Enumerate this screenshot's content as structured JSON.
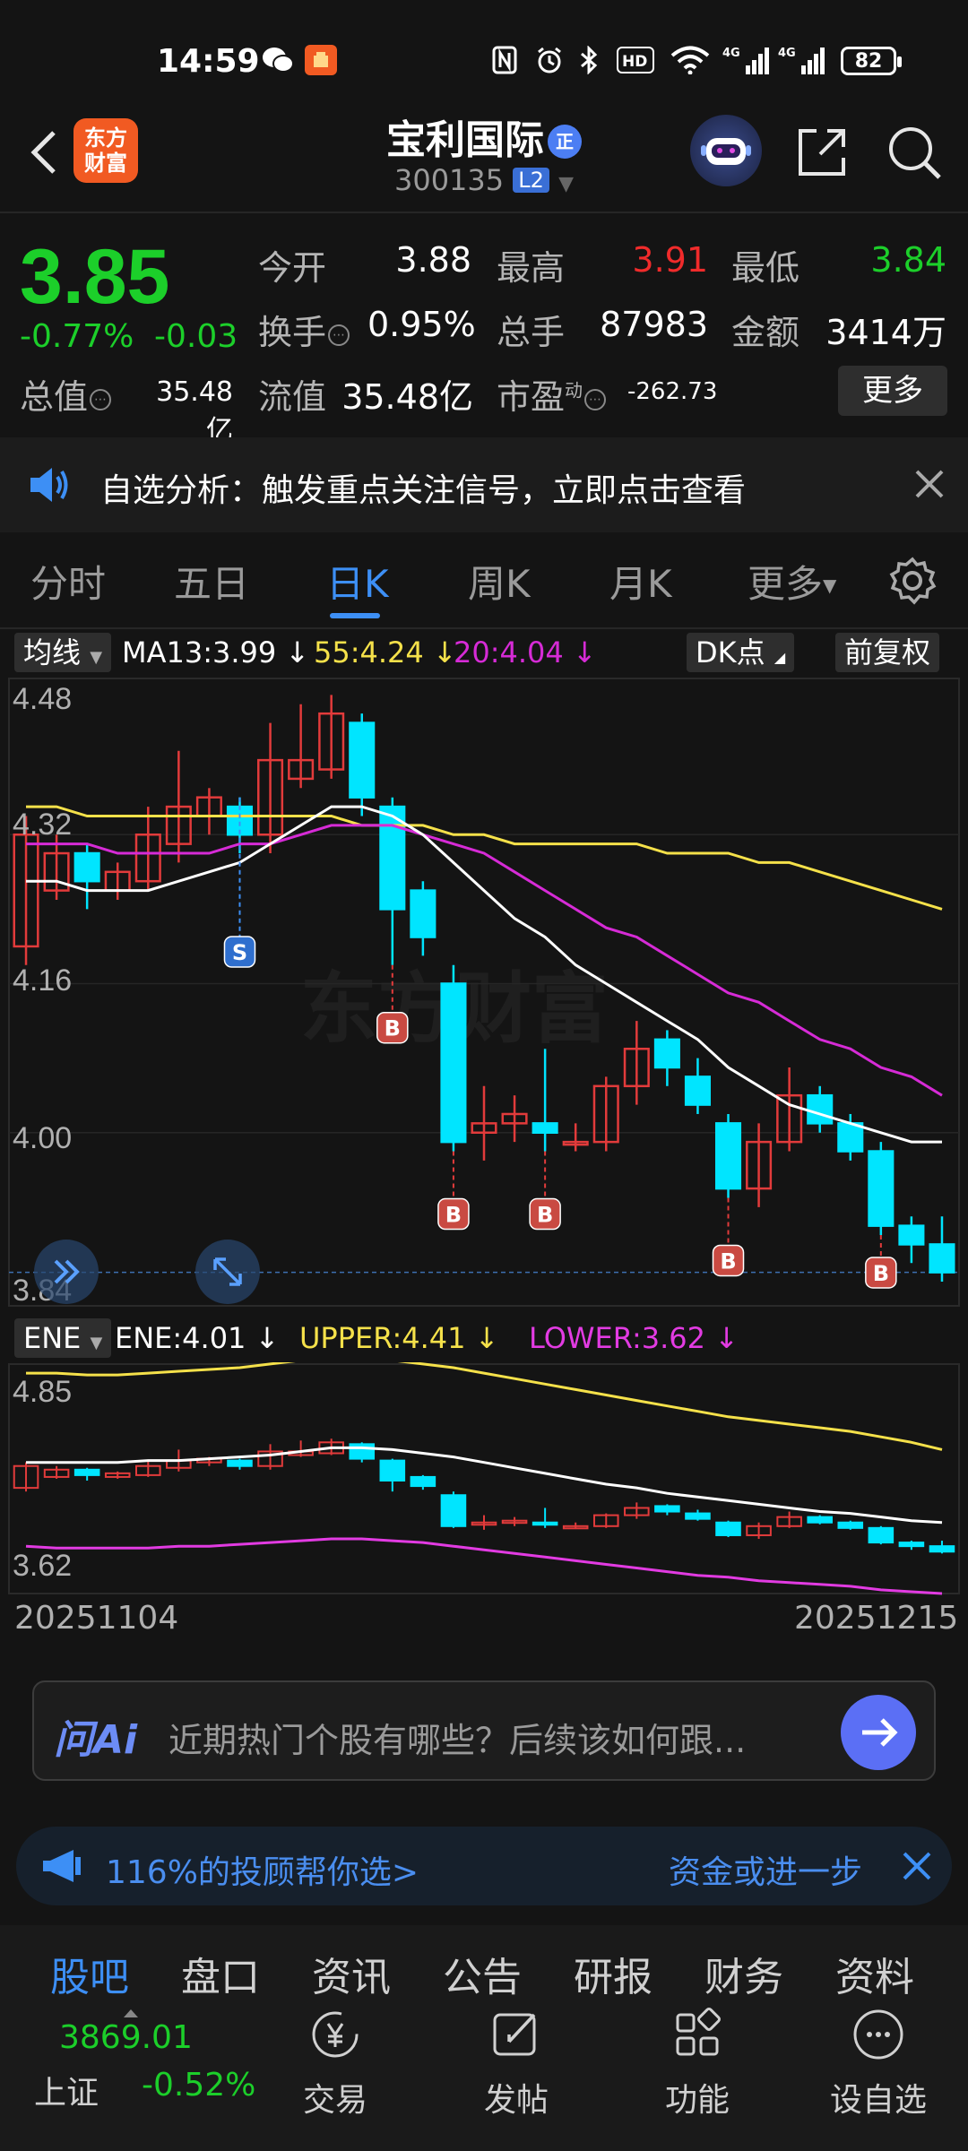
{
  "status_bar": {
    "time": "14:59",
    "battery": "82",
    "net1": "4G",
    "net2": "4G"
  },
  "header": {
    "logo_line1": "东方",
    "logo_line2": "财富",
    "stock_name": "宝利国际",
    "qi_badge": "正",
    "stock_code": "300135",
    "l2_badge": "L2"
  },
  "quote": {
    "price": "3.85",
    "change_pct": "-0.77%",
    "change": "-0.03",
    "open_label": "今开",
    "open": "3.88",
    "high_label": "最高",
    "high": "3.91",
    "low_label": "最低",
    "low": "3.84",
    "turnover_label": "换手",
    "turnover": "0.95%",
    "volume_label": "总手",
    "volume": "87983",
    "amount_label": "金额",
    "amount": "3414万",
    "total_value_label": "总值",
    "total_value": "35.48亿",
    "float_value_label": "流值",
    "float_value": "35.48亿",
    "pe_label": "市盈",
    "pe_sup": "动",
    "pe": "-262.73",
    "more_label": "更多"
  },
  "notice": {
    "text": "自选分析：触发重点关注信号，立即点击查看"
  },
  "tabs": [
    "分时",
    "五日",
    "日K",
    "周K",
    "月K",
    "更多"
  ],
  "active_tab": "日K",
  "chart_header": {
    "selector": "均线",
    "ma13": "MA13:3.99",
    "ma55": "55:4.24",
    "ma20": "20:4.04",
    "dk_label": "DK点",
    "fq_label": "前复权"
  },
  "sub_header": {
    "selector": "ENE",
    "ene": "ENE:4.01",
    "upper": "UPPER:4.41",
    "lower": "LOWER:3.62"
  },
  "colors": {
    "up": "#e23b3b",
    "down": "#00e5ff",
    "ma13": "#ffffff",
    "ma55": "#f5e14a",
    "ma20": "#d62bd6",
    "accent": "#3d8ff5",
    "price_green": "#1ccf2a"
  },
  "chart_data": [
    {
      "type": "candlestick",
      "y_ticks": [
        "4.48",
        "4.32",
        "4.16",
        "4.00",
        "3.84"
      ],
      "ylim": [
        3.84,
        4.48
      ],
      "candles": [
        {
          "o": 4.2,
          "c": 4.32,
          "h": 4.34,
          "l": 4.18
        },
        {
          "o": 4.26,
          "c": 4.3,
          "h": 4.32,
          "l": 4.25
        },
        {
          "o": 4.3,
          "c": 4.27,
          "h": 4.31,
          "l": 4.24
        },
        {
          "o": 4.26,
          "c": 4.28,
          "h": 4.29,
          "l": 4.25
        },
        {
          "o": 4.27,
          "c": 4.32,
          "h": 4.35,
          "l": 4.26
        },
        {
          "o": 4.31,
          "c": 4.35,
          "h": 4.41,
          "l": 4.29
        },
        {
          "o": 4.34,
          "c": 4.36,
          "h": 4.37,
          "l": 4.32
        },
        {
          "o": 4.35,
          "c": 4.32,
          "h": 4.36,
          "l": 4.3
        },
        {
          "o": 4.32,
          "c": 4.4,
          "h": 4.44,
          "l": 4.3
        },
        {
          "o": 4.38,
          "c": 4.4,
          "h": 4.46,
          "l": 4.37
        },
        {
          "o": 4.39,
          "c": 4.45,
          "h": 4.47,
          "l": 4.38
        },
        {
          "o": 4.44,
          "c": 4.36,
          "h": 4.45,
          "l": 4.34
        },
        {
          "o": 4.35,
          "c": 4.24,
          "h": 4.36,
          "l": 4.18
        },
        {
          "o": 4.26,
          "c": 4.21,
          "h": 4.27,
          "l": 4.19
        },
        {
          "o": 4.16,
          "c": 3.99,
          "h": 4.18,
          "l": 3.98
        },
        {
          "o": 4.0,
          "c": 4.01,
          "h": 4.05,
          "l": 3.97
        },
        {
          "o": 4.01,
          "c": 4.02,
          "h": 4.04,
          "l": 3.99
        },
        {
          "o": 4.01,
          "c": 4.0,
          "h": 4.09,
          "l": 3.98
        },
        {
          "o": 3.99,
          "c": 3.99,
          "h": 4.01,
          "l": 3.98
        },
        {
          "o": 3.99,
          "c": 4.05,
          "h": 4.06,
          "l": 3.98
        },
        {
          "o": 4.05,
          "c": 4.09,
          "h": 4.12,
          "l": 4.03
        },
        {
          "o": 4.1,
          "c": 4.07,
          "h": 4.11,
          "l": 4.05
        },
        {
          "o": 4.06,
          "c": 4.03,
          "h": 4.08,
          "l": 4.02
        },
        {
          "o": 4.01,
          "c": 3.94,
          "h": 4.02,
          "l": 3.93
        },
        {
          "o": 3.94,
          "c": 3.99,
          "h": 4.01,
          "l": 3.92
        },
        {
          "o": 3.99,
          "c": 4.04,
          "h": 4.07,
          "l": 3.98
        },
        {
          "o": 4.04,
          "c": 4.01,
          "h": 4.05,
          "l": 4.0
        },
        {
          "o": 4.01,
          "c": 3.98,
          "h": 4.02,
          "l": 3.97
        },
        {
          "o": 3.98,
          "c": 3.9,
          "h": 3.99,
          "l": 3.89
        },
        {
          "o": 3.9,
          "c": 3.88,
          "h": 3.91,
          "l": 3.86
        },
        {
          "o": 3.88,
          "c": 3.85,
          "h": 3.91,
          "l": 3.84
        }
      ],
      "ma13": [
        4.27,
        4.27,
        4.26,
        4.26,
        4.26,
        4.27,
        4.28,
        4.29,
        4.31,
        4.33,
        4.35,
        4.35,
        4.34,
        4.32,
        4.29,
        4.26,
        4.23,
        4.21,
        4.18,
        4.16,
        4.14,
        4.12,
        4.1,
        4.07,
        4.05,
        4.03,
        4.02,
        4.01,
        4.0,
        3.99,
        3.99
      ],
      "ma55": [
        4.35,
        4.35,
        4.34,
        4.34,
        4.34,
        4.34,
        4.34,
        4.34,
        4.34,
        4.34,
        4.34,
        4.33,
        4.33,
        4.33,
        4.32,
        4.32,
        4.31,
        4.31,
        4.31,
        4.31,
        4.31,
        4.3,
        4.3,
        4.3,
        4.29,
        4.29,
        4.28,
        4.27,
        4.26,
        4.25,
        4.24
      ],
      "ma20": [
        4.31,
        4.31,
        4.31,
        4.3,
        4.3,
        4.3,
        4.3,
        4.31,
        4.31,
        4.32,
        4.33,
        4.33,
        4.33,
        4.32,
        4.31,
        4.3,
        4.28,
        4.26,
        4.24,
        4.22,
        4.21,
        4.19,
        4.17,
        4.15,
        4.14,
        4.12,
        4.1,
        4.09,
        4.07,
        4.06,
        4.04
      ],
      "signals": [
        {
          "index": 7,
          "type": "S"
        },
        {
          "index": 12,
          "type": "B"
        },
        {
          "index": 14,
          "type": "B"
        },
        {
          "index": 17,
          "type": "B"
        },
        {
          "index": 23,
          "type": "B"
        },
        {
          "index": 28,
          "type": "B"
        }
      ]
    },
    {
      "type": "line",
      "name": "ENE",
      "y_ticks": [
        "4.85",
        "3.62"
      ],
      "ylim": [
        3.62,
        4.85
      ],
      "upper": [
        4.83,
        4.83,
        4.82,
        4.82,
        4.83,
        4.84,
        4.85,
        4.86,
        4.88,
        4.9,
        4.91,
        4.91,
        4.9,
        4.88,
        4.86,
        4.83,
        4.8,
        4.77,
        4.74,
        4.71,
        4.68,
        4.65,
        4.62,
        4.59,
        4.57,
        4.55,
        4.53,
        4.51,
        4.48,
        4.45,
        4.41
      ],
      "middle": [
        4.34,
        4.34,
        4.34,
        4.34,
        4.35,
        4.35,
        4.36,
        4.37,
        4.38,
        4.4,
        4.42,
        4.42,
        4.41,
        4.39,
        4.37,
        4.34,
        4.31,
        4.28,
        4.25,
        4.22,
        4.2,
        4.17,
        4.15,
        4.13,
        4.11,
        4.09,
        4.07,
        4.06,
        4.04,
        4.02,
        4.01
      ],
      "lower": [
        3.88,
        3.87,
        3.87,
        3.87,
        3.87,
        3.88,
        3.88,
        3.89,
        3.9,
        3.91,
        3.92,
        3.92,
        3.91,
        3.9,
        3.88,
        3.86,
        3.84,
        3.82,
        3.8,
        3.78,
        3.76,
        3.74,
        3.72,
        3.71,
        3.69,
        3.68,
        3.67,
        3.66,
        3.64,
        3.63,
        3.62
      ]
    }
  ],
  "date_start": "20251104",
  "date_end": "20251215",
  "ai_bar": {
    "logo": "问Ai",
    "placeholder": "近期热门个股有哪些？后续该如何跟..."
  },
  "promo": {
    "text": "116%的投顾帮你选>",
    "text2": "资金或进一步"
  },
  "bottom_tabs": [
    "股吧",
    "盘口",
    "资讯",
    "公告",
    "研报",
    "财务",
    "资料"
  ],
  "active_bottom_tab": "股吧",
  "index": {
    "value": "3869.01",
    "name": "上证",
    "change": "-0.52%"
  },
  "nav": [
    {
      "label": "交易",
      "icon": "yen-exchange-icon"
    },
    {
      "label": "发帖",
      "icon": "edit-post-icon"
    },
    {
      "label": "功能",
      "icon": "grid-function-icon"
    },
    {
      "label": "设自选",
      "icon": "add-watchlist-icon"
    }
  ]
}
